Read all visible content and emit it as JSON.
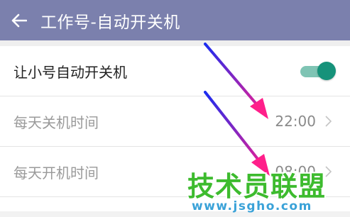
{
  "app_bar": {
    "title": "工作号-自动开关机",
    "back_icon": "arrow-left-icon",
    "background": "#7b80ad"
  },
  "settings": {
    "auto_power": {
      "label": "让小号自动开关机",
      "enabled": true,
      "toggle_color": "#16927a"
    },
    "shutdown_time": {
      "label": "每天关机时间",
      "value": "22:00"
    },
    "startup_time": {
      "label": "每天开机时间",
      "value": "08:00"
    }
  },
  "annotation": {
    "arrow_color_start": "#1a2cf0",
    "arrow_color_end": "#ff1f8a"
  },
  "watermark": {
    "name": "技术员联盟",
    "url": "www.jsgho.com"
  }
}
